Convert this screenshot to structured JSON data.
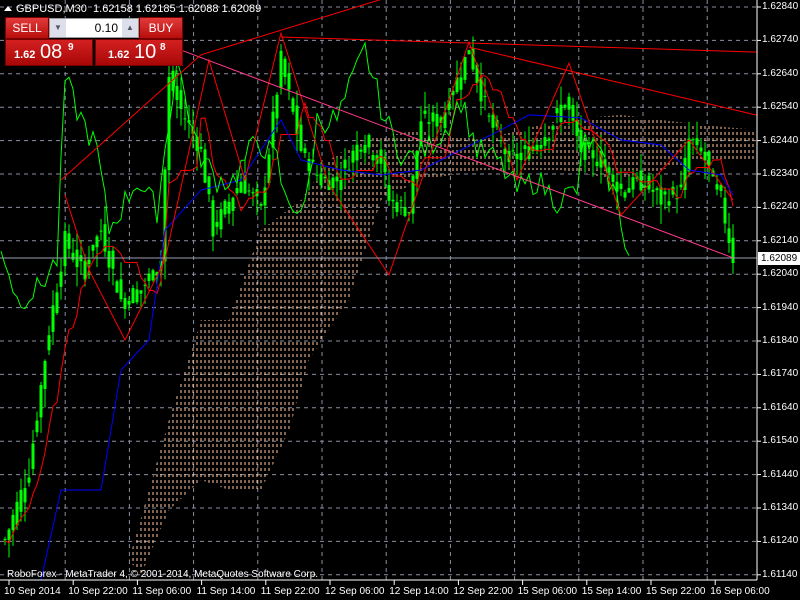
{
  "header": {
    "symbol": "GBPUSD,M30",
    "quotes": "1.62158 1.62185 1.62088 1.62089"
  },
  "trade_panel": {
    "sell_label": "SELL",
    "buy_label": "BUY",
    "lot": "0.10",
    "down_arrow": "▼",
    "up_arrow": "▲",
    "sell_price": {
      "small": "1.62",
      "big": "08",
      "pip": "9"
    },
    "buy_price": {
      "small": "1.62",
      "big": "10",
      "pip": "8"
    }
  },
  "price_axis": [
    "1.62840",
    "1.62740",
    "1.62640",
    "1.62540",
    "1.62440",
    "1.62340",
    "1.62240",
    "1.62140",
    "1.62040",
    "1.61940",
    "1.61840",
    "1.61740",
    "1.61640",
    "1.61540",
    "1.61440",
    "1.61340",
    "1.61240",
    "1.61140"
  ],
  "current_price": "1.62089",
  "time_axis": [
    "10 Sep 2014",
    "10 Sep 22:00",
    "11 Sep 06:00",
    "11 Sep 14:00",
    "11 Sep 22:00",
    "12 Sep 06:00",
    "12 Sep 14:00",
    "12 Sep 22:00",
    "15 Sep 06:00",
    "15 Sep 14:00",
    "15 Sep 22:00",
    "16 Sep 06:00"
  ],
  "copyright": "RoboForex - MetaTrader 4, © 2001-2014, MetaQuotes Software Corp.",
  "colors": {
    "candle": "#00ff00",
    "tenkan": "#ff0000",
    "kijun": "#0000ff",
    "chikou": "#00ff00",
    "zigzag": "#ff0000",
    "trend": "#ff3b8a",
    "cloud": "#ffc8a0",
    "grid": "#8a8fa0"
  },
  "chart_data": {
    "type": "candlestick",
    "price_range": [
      1.6109,
      1.6286
    ],
    "close_path": [
      [
        0,
        1.61244
      ],
      [
        6,
        1.61454
      ],
      [
        11,
        1.61873
      ],
      [
        15,
        1.62142
      ],
      [
        19,
        1.62053
      ],
      [
        24,
        1.62172
      ],
      [
        29,
        1.61963
      ],
      [
        34,
        1.61993
      ],
      [
        39,
        1.62083
      ],
      [
        41,
        1.62621
      ],
      [
        44,
        1.62532
      ],
      [
        49,
        1.62412
      ],
      [
        52,
        1.62172
      ],
      [
        59,
        1.62322
      ],
      [
        64,
        1.62232
      ],
      [
        69,
        1.62681
      ],
      [
        74,
        1.62412
      ],
      [
        79,
        1.62322
      ],
      [
        83,
        1.62322
      ],
      [
        89,
        1.62442
      ],
      [
        94,
        1.62382
      ],
      [
        96,
        1.62262
      ],
      [
        101,
        1.62232
      ],
      [
        104,
        1.62502
      ],
      [
        109,
        1.62502
      ],
      [
        116,
        1.62711
      ],
      [
        121,
        1.62502
      ],
      [
        126,
        1.62382
      ],
      [
        131,
        1.62412
      ],
      [
        136,
        1.62472
      ],
      [
        140,
        1.62562
      ],
      [
        144,
        1.62412
      ],
      [
        149,
        1.62382
      ],
      [
        154,
        1.62292
      ],
      [
        159,
        1.62322
      ],
      [
        164,
        1.62262
      ],
      [
        169,
        1.62292
      ],
      [
        171,
        1.62442
      ],
      [
        174,
        1.62412
      ],
      [
        179,
        1.62262
      ],
      [
        182,
        1.62089
      ]
    ],
    "kijun": [
      [
        9,
        1.61124
      ],
      [
        14,
        1.61394
      ],
      [
        24,
        1.61394
      ],
      [
        29,
        1.61753
      ],
      [
        36,
        1.61843
      ],
      [
        40,
        1.62172
      ],
      [
        49,
        1.62292
      ],
      [
        59,
        1.62322
      ],
      [
        64,
        1.62412
      ],
      [
        69,
        1.62502
      ],
      [
        74,
        1.62382
      ],
      [
        84,
        1.62352
      ],
      [
        94,
        1.62337
      ],
      [
        104,
        1.62352
      ],
      [
        114,
        1.62412
      ],
      [
        124,
        1.62472
      ],
      [
        131,
        1.62517
      ],
      [
        144,
        1.62508
      ],
      [
        154,
        1.62442
      ],
      [
        164,
        1.62427
      ],
      [
        171,
        1.62352
      ],
      [
        179,
        1.62337
      ],
      [
        182,
        1.62277
      ]
    ],
    "zigzag": [
      [
        15,
        1.62277
      ],
      [
        21,
        1.62053
      ],
      [
        30,
        1.61843
      ],
      [
        40,
        1.62083
      ],
      [
        51,
        1.62681
      ],
      [
        60,
        1.62322
      ],
      [
        69,
        1.62762
      ],
      [
        81,
        1.62307
      ],
      [
        96,
        1.62038
      ],
      [
        116,
        1.62735
      ],
      [
        128,
        1.62322
      ],
      [
        141,
        1.62672
      ],
      [
        154,
        1.62217
      ],
      [
        171,
        1.62442
      ],
      [
        182,
        1.62262
      ]
    ],
    "cloud_upper": [
      [
        31,
        1.61184
      ],
      [
        41,
        1.61603
      ],
      [
        49,
        1.61903
      ],
      [
        56,
        1.61903
      ],
      [
        64,
        1.62172
      ],
      [
        74,
        1.62262
      ],
      [
        81,
        1.62382
      ],
      [
        89,
        1.62442
      ],
      [
        104,
        1.62472
      ],
      [
        119,
        1.62442
      ],
      [
        139,
        1.62502
      ],
      [
        154,
        1.62517
      ],
      [
        174,
        1.62487
      ],
      [
        188,
        1.62472
      ]
    ],
    "cloud_lower": [
      [
        34,
        1.6114
      ],
      [
        41,
        1.61334
      ],
      [
        49,
        1.61424
      ],
      [
        56,
        1.61394
      ],
      [
        64,
        1.61394
      ],
      [
        71,
        1.61573
      ],
      [
        76,
        1.61783
      ],
      [
        86,
        1.61963
      ],
      [
        94,
        1.62262
      ],
      [
        104,
        1.62322
      ],
      [
        119,
        1.62352
      ],
      [
        139,
        1.62352
      ],
      [
        154,
        1.62322
      ],
      [
        174,
        1.62382
      ],
      [
        188,
        1.62382
      ]
    ],
    "trendlines": [
      {
        "color": "trend",
        "points": [
          [
            44,
            1.62711
          ],
          [
            182,
            1.62089
          ]
        ]
      },
      {
        "color": "zigzag",
        "points": [
          [
            69,
            1.6275
          ],
          [
            188,
            1.62705
          ]
        ]
      },
      {
        "color": "zigzag",
        "points": [
          [
            116,
            1.6272
          ],
          [
            188,
            1.62516
          ]
        ]
      },
      {
        "color": "zigzag",
        "points": [
          [
            14,
            1.62322
          ],
          [
            49,
            1.62697
          ],
          [
            96,
            1.6287
          ]
        ]
      }
    ]
  }
}
